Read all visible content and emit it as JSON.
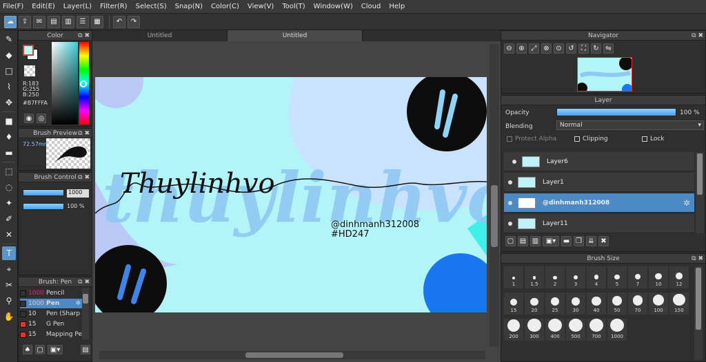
{
  "menu": [
    "File(F)",
    "Edit(E)",
    "Layer(L)",
    "Filter(R)",
    "Select(S)",
    "Snap(N)",
    "Color(C)",
    "View(V)",
    "Tool(T)",
    "Window(W)",
    "Cloud",
    "Help"
  ],
  "tabs": [
    "Untitled",
    "Untitled"
  ],
  "color_panel": {
    "title": "Color",
    "r": "R:183",
    "g": "G:255",
    "b": "B:250",
    "hex": "#B7FFFA",
    "fg": "#b7fffa",
    "bg": "#ffffff"
  },
  "brush_preview": {
    "title": "Brush Preview",
    "size": "72.57mm"
  },
  "brush_control": {
    "title": "Brush Control",
    "size": "1000",
    "opacity": "100 %",
    "size_level": 1.0,
    "opacity_level": 1.0
  },
  "brush_list": {
    "title": "Brush: Pen",
    "items": [
      {
        "size": "1000",
        "name": "Pencil",
        "color": "#333333"
      },
      {
        "size": "1000",
        "name": "Pen",
        "color": "#333333"
      },
      {
        "size": "10",
        "name": "Pen (Sharp",
        "color": "#333333"
      },
      {
        "size": "15",
        "name": "G Pen",
        "color": "#e53333"
      },
      {
        "size": "15",
        "name": "Mapping Pe",
        "color": "#e53333"
      }
    ]
  },
  "navigator": {
    "title": "Navigator"
  },
  "layer_panel": {
    "title": "Layer",
    "opacity_label": "Opacity",
    "opacity_value": "100 %",
    "opacity_level": 1.0,
    "blending_label": "Blending",
    "blending_value": "Normal",
    "protect_alpha": "Protect Alpha",
    "clipping": "Clipping",
    "lock": "Lock",
    "layers": [
      {
        "name": "Layer6"
      },
      {
        "name": "Layer1"
      },
      {
        "name": "@dinhmanh312008"
      },
      {
        "name": "Layer11"
      }
    ]
  },
  "brush_size": {
    "title": "Brush Size",
    "sizes": [
      "1",
      "1.5",
      "2",
      "3",
      "4",
      "5",
      "7",
      "10",
      "12",
      "15",
      "20",
      "25",
      "30",
      "40",
      "50",
      "70",
      "100",
      "150",
      "200",
      "300",
      "400",
      "500",
      "700",
      "1000"
    ]
  },
  "artwork": {
    "watermark": "thuylinhvo",
    "signature": "Thuylinhvo",
    "handle": "@dinhmanh312008",
    "tag": "#HD247",
    "colors": {
      "bg": "#b2f4f8",
      "blob": "#c9e3ff",
      "lilac": "#b9c8f5",
      "blue": "#1877f0",
      "black": "#0d0d0d",
      "mark": "#8fd4f6",
      "mark2": "#3f85e8"
    }
  }
}
